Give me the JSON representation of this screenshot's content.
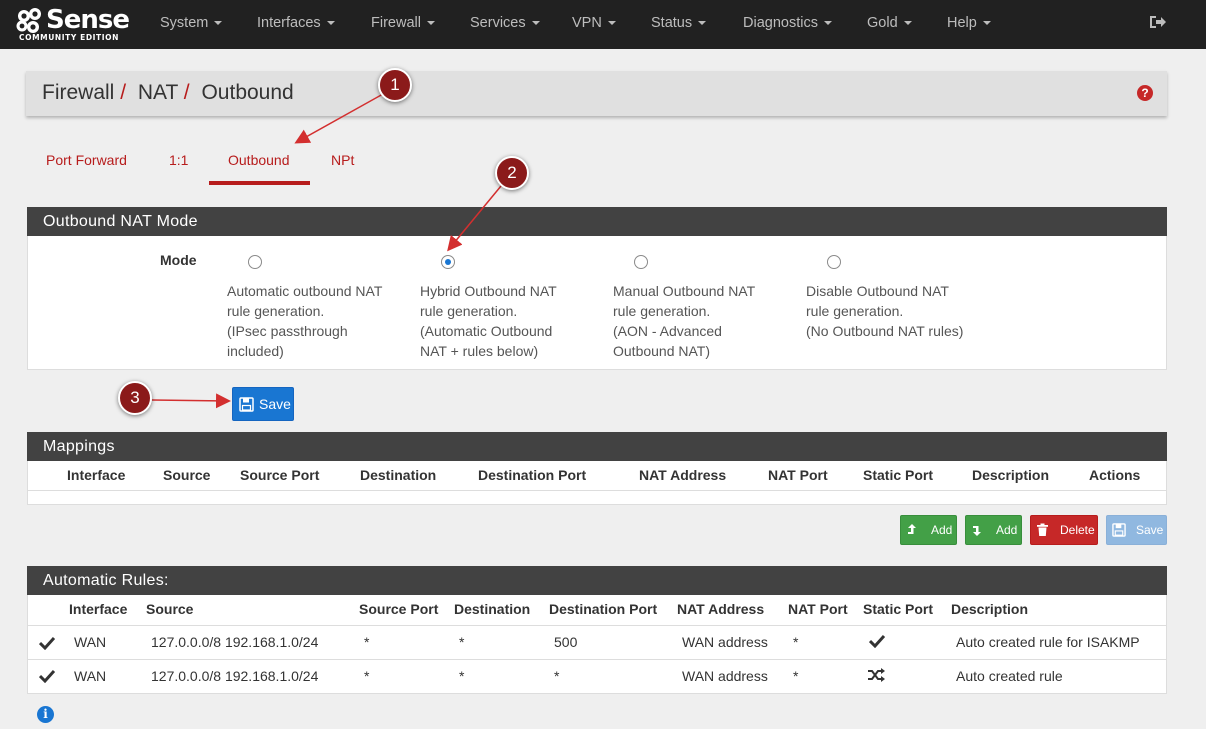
{
  "brand": {
    "name_prefix": "",
    "name": "Sense",
    "edition": "COMMUNITY EDITION"
  },
  "nav": {
    "items": [
      "System",
      "Interfaces",
      "Firewall",
      "Services",
      "VPN",
      "Status",
      "Diagnostics",
      "Gold",
      "Help"
    ]
  },
  "breadcrumb": {
    "part1": "Firewall",
    "part2": "NAT",
    "part3": "Outbound",
    "sep": "/"
  },
  "tabs": [
    "Port Forward",
    "1:1",
    "Outbound",
    "NPt"
  ],
  "mode_panel": {
    "title": "Outbound NAT Mode",
    "label": "Mode",
    "options": [
      {
        "lines": [
          "Automatic outbound NAT",
          "rule generation.",
          "(IPsec passthrough",
          "included)"
        ],
        "selected": false
      },
      {
        "lines": [
          "Hybrid Outbound NAT",
          "rule generation.",
          "(Automatic Outbound",
          "NAT + rules below)"
        ],
        "selected": true
      },
      {
        "lines": [
          "Manual Outbound NAT",
          "rule generation.",
          "(AON - Advanced",
          "Outbound NAT)"
        ],
        "selected": false
      },
      {
        "lines": [
          "Disable Outbound NAT",
          "rule generation.",
          "(No Outbound NAT rules)"
        ],
        "selected": false
      }
    ],
    "save_label": "Save"
  },
  "mappings": {
    "title": "Mappings",
    "columns": [
      "Interface",
      "Source",
      "Source Port",
      "Destination",
      "Destination Port",
      "NAT Address",
      "NAT Port",
      "Static Port",
      "Description",
      "Actions"
    ],
    "buttons": {
      "add_top": "Add",
      "add_bottom": "Add",
      "delete": "Delete",
      "save": "Save"
    }
  },
  "auto_rules": {
    "title": "Automatic Rules:",
    "columns": [
      "Interface",
      "Source",
      "Source Port",
      "Destination",
      "Destination Port",
      "NAT Address",
      "NAT Port",
      "Static Port",
      "Description"
    ],
    "rows": [
      {
        "interface": "WAN",
        "source": "127.0.0.0/8 192.168.1.0/24",
        "source_port": "*",
        "destination": "*",
        "destination_port": "500",
        "nat_address": "WAN address",
        "nat_port": "*",
        "static_port_icon": "check-icon",
        "description": "Auto created rule for ISAKMP"
      },
      {
        "interface": "WAN",
        "source": "127.0.0.0/8 192.168.1.0/24",
        "source_port": "*",
        "destination": "*",
        "destination_port": "*",
        "nat_address": "WAN address",
        "nat_port": "*",
        "static_port_icon": "shuffle-icon",
        "description": "Auto created rule"
      }
    ]
  },
  "annotations": [
    "1",
    "2",
    "3"
  ],
  "colors": {
    "accent": "#b71c1c",
    "navbar": "#212121",
    "panel_header": "#424242",
    "primary": "#1976d2",
    "success": "#43a047",
    "danger": "#c62828"
  }
}
